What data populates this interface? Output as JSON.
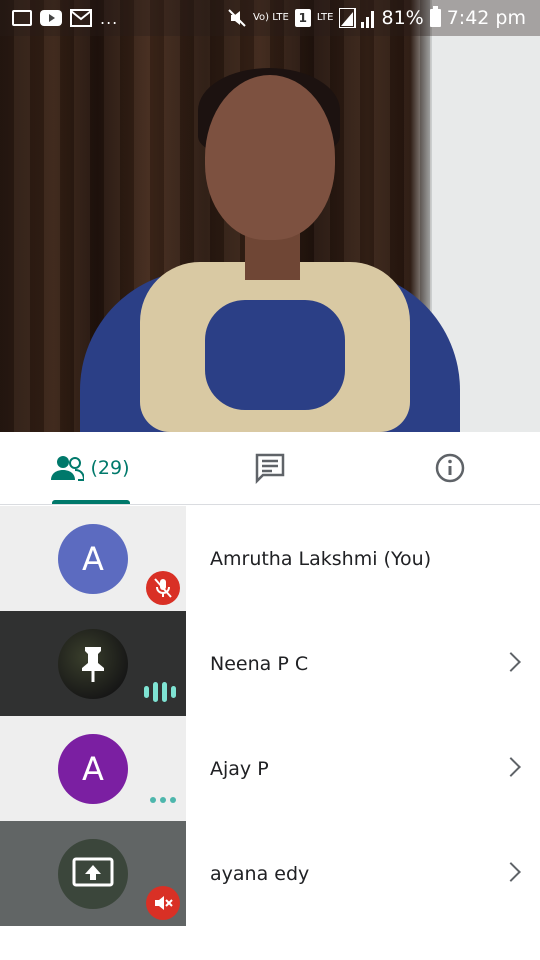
{
  "status_bar": {
    "lte_label": "Vo) LTE",
    "sim_label": "1",
    "lte2_label": "LTE",
    "battery": "81%",
    "time": "7:42 pm",
    "dots": "..."
  },
  "tabs": {
    "people_count": "(29)"
  },
  "colors": {
    "accent": "#00796b",
    "mute_red": "#d93025"
  },
  "participants": [
    {
      "initial": "A",
      "name": "Amrutha Lakshmi (You)",
      "avatar_color": "#5c6bc0",
      "status": "muted"
    },
    {
      "initial": "",
      "name": "Neena P C",
      "status": "speaking",
      "icon": "pin-icon"
    },
    {
      "initial": "A",
      "name": "Ajay P",
      "avatar_color": "#7b1fa2",
      "status": "idle"
    },
    {
      "initial": "",
      "name": "ayana edy",
      "status": "muted-speaker",
      "icon": "present-screen-icon"
    }
  ]
}
